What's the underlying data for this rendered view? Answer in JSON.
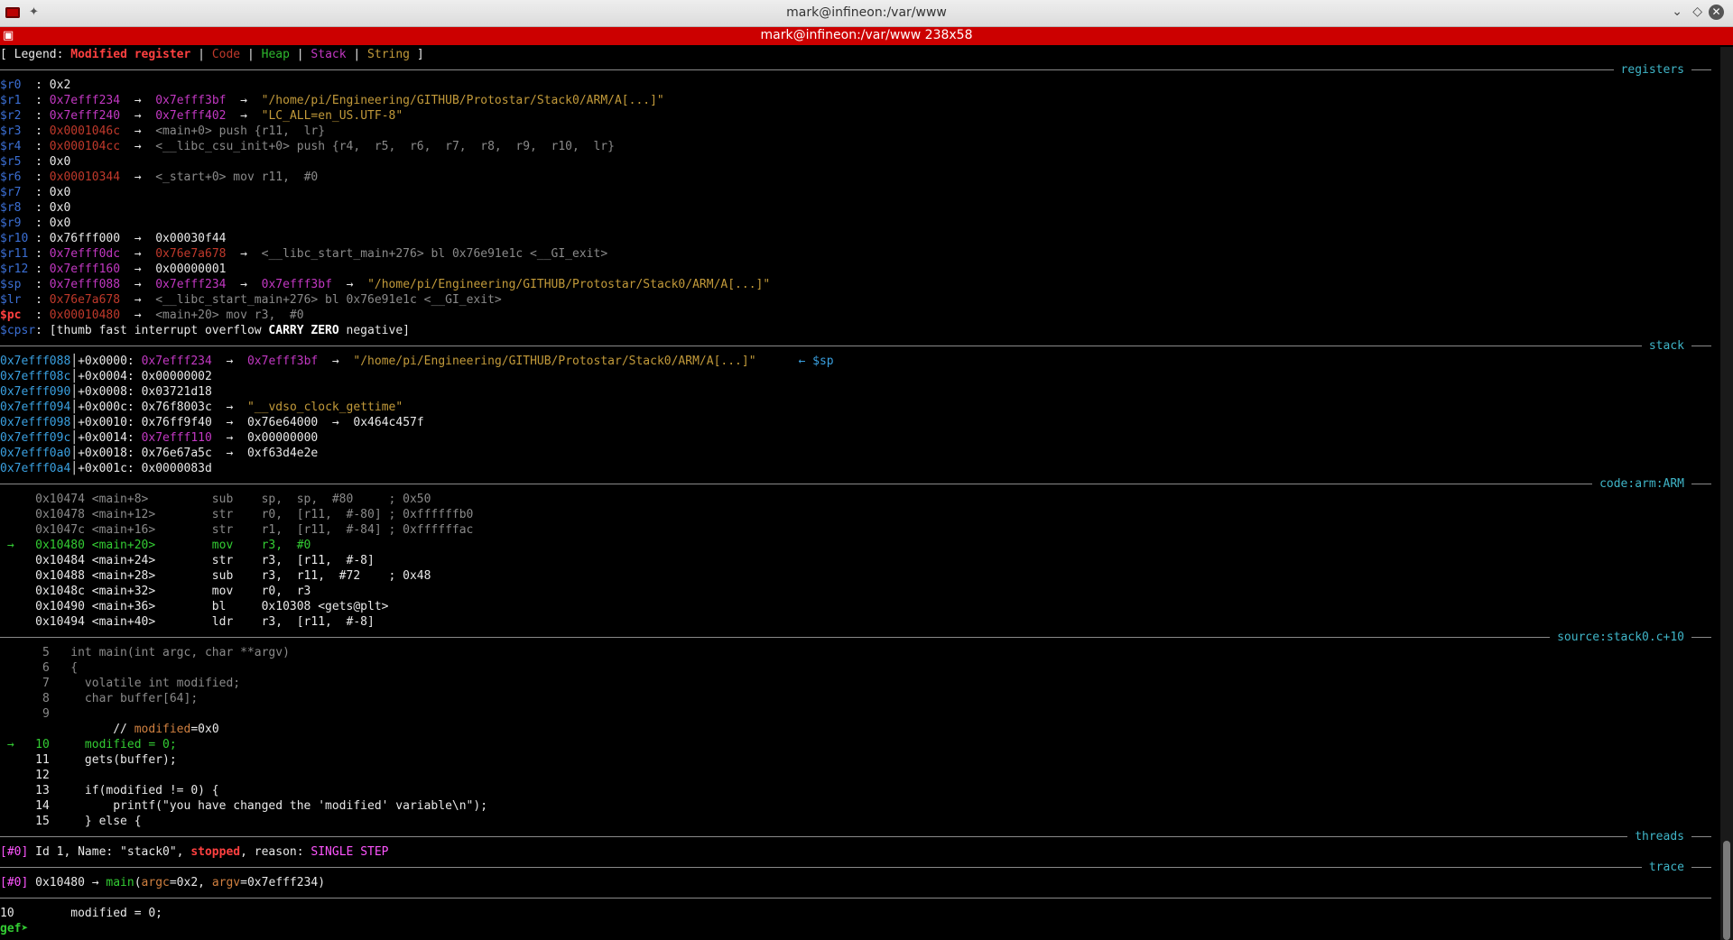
{
  "window": {
    "title": "mark@infineon:/var/www",
    "tab_title": "mark@infineon:/var/www 238x58"
  },
  "legend": {
    "prefix": "[ Legend: ",
    "modified": "Modified register",
    "sep": " | ",
    "code": "Code",
    "heap": "Heap",
    "stack": "Stack",
    "string": "String",
    "suffix": " ]"
  },
  "sections": {
    "registers": "registers",
    "stack": "stack",
    "code": "code:arm:ARM",
    "source": "source:stack0.c+10",
    "threads": "threads",
    "trace": "trace"
  },
  "registers": [
    {
      "name": "$r0",
      "segs": [
        {
          "t": "  : ",
          "c": "white"
        },
        {
          "t": "0x2",
          "c": "white"
        }
      ]
    },
    {
      "name": "$r1",
      "segs": [
        {
          "t": "  : ",
          "c": "white"
        },
        {
          "t": "0x7efff234",
          "c": "stack"
        },
        {
          "t": "  →  ",
          "c": "white"
        },
        {
          "t": "0x7efff3bf",
          "c": "stack"
        },
        {
          "t": "  →  ",
          "c": "white"
        },
        {
          "t": "\"/home/pi/Engineering/GITHUB/Protostar/Stack0/ARM/A[...]\"",
          "c": "string"
        }
      ]
    },
    {
      "name": "$r2",
      "segs": [
        {
          "t": "  : ",
          "c": "white"
        },
        {
          "t": "0x7efff240",
          "c": "stack"
        },
        {
          "t": "  →  ",
          "c": "white"
        },
        {
          "t": "0x7efff402",
          "c": "stack"
        },
        {
          "t": "  →  ",
          "c": "white"
        },
        {
          "t": "\"LC_ALL=en_US.UTF-8\"",
          "c": "string"
        }
      ]
    },
    {
      "name": "$r3",
      "segs": [
        {
          "t": "  : ",
          "c": "white"
        },
        {
          "t": "0x0001046c",
          "c": "code"
        },
        {
          "t": "  →  ",
          "c": "white"
        },
        {
          "t": "<main+0> push {r11,  lr}",
          "c": "gray"
        }
      ]
    },
    {
      "name": "$r4",
      "segs": [
        {
          "t": "  : ",
          "c": "white"
        },
        {
          "t": "0x000104cc",
          "c": "code"
        },
        {
          "t": "  →  ",
          "c": "white"
        },
        {
          "t": "<__libc_csu_init+0> push {r4,  r5,  r6,  r7,  r8,  r9,  r10,  lr}",
          "c": "gray"
        }
      ]
    },
    {
      "name": "$r5",
      "segs": [
        {
          "t": "  : ",
          "c": "white"
        },
        {
          "t": "0x0",
          "c": "white"
        }
      ]
    },
    {
      "name": "$r6",
      "segs": [
        {
          "t": "  : ",
          "c": "white"
        },
        {
          "t": "0x00010344",
          "c": "code"
        },
        {
          "t": "  →  ",
          "c": "white"
        },
        {
          "t": "<_start+0> mov r11,  #0",
          "c": "gray"
        }
      ]
    },
    {
      "name": "$r7",
      "segs": [
        {
          "t": "  : ",
          "c": "white"
        },
        {
          "t": "0x0",
          "c": "white"
        }
      ]
    },
    {
      "name": "$r8",
      "segs": [
        {
          "t": "  : ",
          "c": "white"
        },
        {
          "t": "0x0",
          "c": "white"
        }
      ]
    },
    {
      "name": "$r9",
      "segs": [
        {
          "t": "  : ",
          "c": "white"
        },
        {
          "t": "0x0",
          "c": "white"
        }
      ]
    },
    {
      "name": "$r10",
      "segs": [
        {
          "t": " : ",
          "c": "white"
        },
        {
          "t": "0x76fff000",
          "c": "white"
        },
        {
          "t": "  →  ",
          "c": "white"
        },
        {
          "t": "0x00030f44",
          "c": "white"
        }
      ]
    },
    {
      "name": "$r11",
      "segs": [
        {
          "t": " : ",
          "c": "white"
        },
        {
          "t": "0x7efff0dc",
          "c": "stack"
        },
        {
          "t": "  →  ",
          "c": "white"
        },
        {
          "t": "0x76e7a678",
          "c": "code"
        },
        {
          "t": "  →  ",
          "c": "white"
        },
        {
          "t": "<__libc_start_main+276> bl 0x76e91e1c <__GI_exit>",
          "c": "gray"
        }
      ]
    },
    {
      "name": "$r12",
      "segs": [
        {
          "t": " : ",
          "c": "white"
        },
        {
          "t": "0x7efff160",
          "c": "stack"
        },
        {
          "t": "  →  ",
          "c": "white"
        },
        {
          "t": "0x00000001",
          "c": "white"
        }
      ]
    },
    {
      "name": "$sp",
      "segs": [
        {
          "t": "  : ",
          "c": "white"
        },
        {
          "t": "0x7efff088",
          "c": "stack"
        },
        {
          "t": "  →  ",
          "c": "white"
        },
        {
          "t": "0x7efff234",
          "c": "stack"
        },
        {
          "t": "  →  ",
          "c": "white"
        },
        {
          "t": "0x7efff3bf",
          "c": "stack"
        },
        {
          "t": "  →  ",
          "c": "white"
        },
        {
          "t": "\"/home/pi/Engineering/GITHUB/Protostar/Stack0/ARM/A[...]\"",
          "c": "string"
        }
      ]
    },
    {
      "name": "$lr",
      "segs": [
        {
          "t": "  : ",
          "c": "white"
        },
        {
          "t": "0x76e7a678",
          "c": "code"
        },
        {
          "t": "  →  ",
          "c": "white"
        },
        {
          "t": "<__libc_start_main+276> bl 0x76e91e1c <__GI_exit>",
          "c": "gray"
        }
      ]
    },
    {
      "name": "$pc",
      "pc": true,
      "segs": [
        {
          "t": "  : ",
          "c": "white"
        },
        {
          "t": "0x00010480",
          "c": "code"
        },
        {
          "t": "  →  ",
          "c": "white"
        },
        {
          "t": "<main+20> mov r3,  #0",
          "c": "gray"
        }
      ]
    },
    {
      "name": "$cpsr",
      "segs": [
        {
          "t": ": [thumb fast interrupt overflow ",
          "c": "white"
        },
        {
          "t": "CARRY",
          "c": "bold"
        },
        {
          "t": " ",
          "c": "white"
        },
        {
          "t": "ZERO",
          "c": "bold"
        },
        {
          "t": " negative]",
          "c": "white"
        }
      ]
    }
  ],
  "stack": [
    {
      "addr": "0x7efff088",
      "segs": [
        {
          "t": "+0x0000: ",
          "c": "white"
        },
        {
          "t": "0x7efff234",
          "c": "stack"
        },
        {
          "t": "  →  ",
          "c": "white"
        },
        {
          "t": "0x7efff3bf",
          "c": "stack"
        },
        {
          "t": "  →  ",
          "c": "white"
        },
        {
          "t": "\"/home/pi/Engineering/GITHUB/Protostar/Stack0/ARM/A[...]\"",
          "c": "string"
        },
        {
          "t": "      ← ",
          "c": "sp"
        },
        {
          "t": "$sp",
          "c": "sp"
        }
      ]
    },
    {
      "addr": "0x7efff08c",
      "segs": [
        {
          "t": "+0x0004: ",
          "c": "white"
        },
        {
          "t": "0x00000002",
          "c": "white"
        }
      ]
    },
    {
      "addr": "0x7efff090",
      "segs": [
        {
          "t": "+0x0008: ",
          "c": "white"
        },
        {
          "t": "0x03721d18",
          "c": "white"
        }
      ]
    },
    {
      "addr": "0x7efff094",
      "segs": [
        {
          "t": "+0x000c: ",
          "c": "white"
        },
        {
          "t": "0x76f8003c",
          "c": "white"
        },
        {
          "t": "  →  ",
          "c": "white"
        },
        {
          "t": "\"__vdso_clock_gettime\"",
          "c": "string"
        }
      ]
    },
    {
      "addr": "0x7efff098",
      "segs": [
        {
          "t": "+0x0010: ",
          "c": "white"
        },
        {
          "t": "0x76ff9f40",
          "c": "white"
        },
        {
          "t": "  →  ",
          "c": "white"
        },
        {
          "t": "0x76e64000",
          "c": "white"
        },
        {
          "t": "  →  ",
          "c": "white"
        },
        {
          "t": "0x464c457f",
          "c": "white"
        }
      ]
    },
    {
      "addr": "0x7efff09c",
      "segs": [
        {
          "t": "+0x0014: ",
          "c": "white"
        },
        {
          "t": "0x7efff110",
          "c": "stack"
        },
        {
          "t": "  →  ",
          "c": "white"
        },
        {
          "t": "0x00000000",
          "c": "white"
        }
      ]
    },
    {
      "addr": "0x7efff0a0",
      "segs": [
        {
          "t": "+0x0018: ",
          "c": "white"
        },
        {
          "t": "0x76e67a5c",
          "c": "white"
        },
        {
          "t": "  →  ",
          "c": "white"
        },
        {
          "t": "0xf63d4e2e",
          "c": "white"
        }
      ]
    },
    {
      "addr": "0x7efff0a4",
      "segs": [
        {
          "t": "+0x001c: ",
          "c": "white"
        },
        {
          "t": "0x0000083d",
          "c": "white"
        }
      ]
    }
  ],
  "code": [
    {
      "text": "     0x10474 <main+8>         sub    sp,  sp,  #80     ; 0x50",
      "c": "gray"
    },
    {
      "text": "     0x10478 <main+12>        str    r0,  [r11,  #-80] ; 0xffffffb0",
      "c": "gray"
    },
    {
      "text": "     0x1047c <main+16>        str    r1,  [r11,  #-84] ; 0xffffffac",
      "c": "gray"
    },
    {
      "text": " →   0x10480 <main+20>        mov    r3,  #0",
      "c": "green"
    },
    {
      "text": "     0x10484 <main+24>        str    r3,  [r11,  #-8]",
      "c": "white"
    },
    {
      "text": "     0x10488 <main+28>        sub    r3,  r11,  #72    ; 0x48",
      "c": "white"
    },
    {
      "text": "     0x1048c <main+32>        mov    r0,  r3",
      "c": "white"
    },
    {
      "text": "     0x10490 <main+36>        bl     0x10308 <gets@plt>",
      "c": "white"
    },
    {
      "text": "     0x10494 <main+40>        ldr    r3,  [r11,  #-8]",
      "c": "white"
    }
  ],
  "source": [
    {
      "segs": [
        {
          "t": "      5   int main(int argc, char **argv)",
          "c": "gray"
        }
      ]
    },
    {
      "segs": [
        {
          "t": "      6   {",
          "c": "gray"
        }
      ]
    },
    {
      "segs": [
        {
          "t": "      7     volatile int modified;",
          "c": "gray"
        }
      ]
    },
    {
      "segs": [
        {
          "t": "      8     char buffer[64];",
          "c": "gray"
        }
      ]
    },
    {
      "segs": [
        {
          "t": "      9",
          "c": "gray"
        }
      ]
    },
    {
      "segs": [
        {
          "t": "                // ",
          "c": "white"
        },
        {
          "t": "modified",
          "c": "orange"
        },
        {
          "t": "=0x0",
          "c": "white"
        }
      ]
    },
    {
      "segs": [
        {
          "t": " →   10     modified = 0;",
          "c": "green"
        }
      ]
    },
    {
      "segs": [
        {
          "t": "     11     gets(buffer);",
          "c": "white"
        }
      ]
    },
    {
      "segs": [
        {
          "t": "     12",
          "c": "white"
        }
      ]
    },
    {
      "segs": [
        {
          "t": "     13     if(modified != 0) {",
          "c": "white"
        }
      ]
    },
    {
      "segs": [
        {
          "t": "     14         printf(\"you have changed the 'modified' variable\\n\");",
          "c": "white"
        }
      ]
    },
    {
      "segs": [
        {
          "t": "     15     } else {",
          "c": "white"
        }
      ]
    }
  ],
  "threads": [
    {
      "segs": [
        {
          "t": "[#0]",
          "c": "magenta"
        },
        {
          "t": " Id 1, Name: \"stack0\", ",
          "c": "white"
        },
        {
          "t": "stopped",
          "c": "stopped"
        },
        {
          "t": ", reason: ",
          "c": "white"
        },
        {
          "t": "SINGLE STEP",
          "c": "magenta"
        }
      ]
    }
  ],
  "trace": [
    {
      "segs": [
        {
          "t": "[#0]",
          "c": "magenta"
        },
        {
          "t": " 0x10480 → ",
          "c": "white"
        },
        {
          "t": "main",
          "c": "green"
        },
        {
          "t": "(",
          "c": "white"
        },
        {
          "t": "argc",
          "c": "orange"
        },
        {
          "t": "=0x2, ",
          "c": "white"
        },
        {
          "t": "argv",
          "c": "orange"
        },
        {
          "t": "=0x7efff234)",
          "c": "white"
        }
      ]
    }
  ],
  "current_line": "10        modified = 0;",
  "prompt": "gef➤ "
}
